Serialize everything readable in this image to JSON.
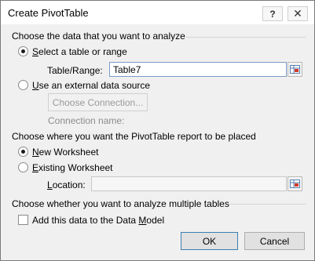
{
  "window": {
    "title": "Create PivotTable",
    "help_glyph": "?",
    "close_glyph": "✕"
  },
  "source_section": {
    "title": "Choose the data that you want to analyze",
    "select_table_prefix": "S",
    "select_table_rest": "elect a table or range",
    "select_table_checked": true,
    "table_range_label": "Table/Range:",
    "table_range_value": "Table7",
    "external_prefix": "U",
    "external_rest": "se an external data source",
    "external_checked": false,
    "choose_connection_label": "Choose Connection...",
    "connection_name_label": "Connection name:"
  },
  "placement_section": {
    "title": "Choose where you want the PivotTable report to be placed",
    "new_ws_prefix": "N",
    "new_ws_rest": "ew Worksheet",
    "new_ws_checked": true,
    "existing_ws_prefix": "E",
    "existing_ws_rest": "xisting Worksheet",
    "existing_ws_checked": false,
    "location_prefix": "L",
    "location_rest": "ocation:",
    "location_value": ""
  },
  "multi_section": {
    "title": "Choose whether you want to analyze multiple tables",
    "data_model_before": "Add this data to the Data ",
    "data_model_ul": "M",
    "data_model_after": "odel",
    "data_model_checked": false
  },
  "buttons": {
    "ok_label": "OK",
    "cancel_label": "Cancel"
  }
}
